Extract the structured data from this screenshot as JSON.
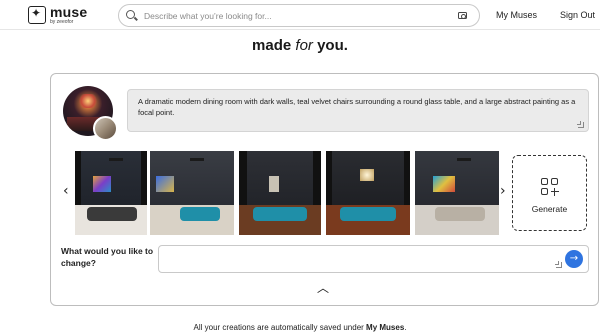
{
  "brand": {
    "name": "muse",
    "sub": "by zeeofor"
  },
  "search": {
    "placeholder": "Describe what you’re looking for..."
  },
  "nav": {
    "my_muses": "My Muses",
    "sign_out": "Sign Out"
  },
  "heading": {
    "pre": "made ",
    "em": "for",
    "post": " you."
  },
  "prompt": {
    "text": "A dramatic modern dining room with dark walls, teal velvet chairs surrounding a round glass table, and a large abstract painting as a focal point."
  },
  "carousel": {
    "prev": "‹",
    "next": "›",
    "images": [
      {
        "name": "dining-room-variation-1"
      },
      {
        "name": "dining-room-variation-2"
      },
      {
        "name": "dining-room-variation-3"
      },
      {
        "name": "dining-room-variation-4"
      },
      {
        "name": "dining-room-variation-5"
      }
    ],
    "generate_label": "Generate"
  },
  "change": {
    "label": "What would you like to change?",
    "value": ""
  },
  "footer": {
    "pre": "All your creations are automatically saved under ",
    "link": "My Muses",
    "post": "."
  },
  "colors": {
    "accent": "#2f74e0",
    "teal": "#1f8fa8"
  }
}
